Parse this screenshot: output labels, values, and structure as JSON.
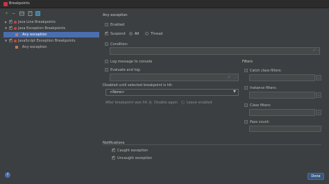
{
  "window": {
    "title": "Breakpoints"
  },
  "toolbar": {
    "add": "+",
    "remove": "−"
  },
  "tree": {
    "items": [
      {
        "label": "Java Line Breakpoints",
        "level": 0,
        "expanded": false,
        "checked": true
      },
      {
        "label": "Java Exception Breakpoints",
        "level": 0,
        "expanded": true,
        "checked": true
      },
      {
        "label": "Any exception",
        "level": 1,
        "selected": true
      },
      {
        "label": "JavaScript Exception Breakpoints",
        "level": 0,
        "expanded": true,
        "checked": true
      },
      {
        "label": "Any exception",
        "level": 1,
        "selected": false
      }
    ]
  },
  "details": {
    "title": "Any exception",
    "enabled": "Enabled",
    "suspend": "Suspend",
    "suspend_all": "All",
    "suspend_thread": "Thread",
    "condition": "Condition:",
    "log_message": "Log message to console",
    "evaluate_log": "Evaluate and log:",
    "disabled_until": "Disabled until selected breakpoint is hit:",
    "disabled_until_value": "<None>",
    "after_hit": "After breakpoint was hit",
    "disable_again": "Disable again",
    "leave_enabled": "Leave enabled",
    "filters_title": "Filters",
    "catch_class_filters": "Catch class filters:",
    "instance_filters": "Instance filters:",
    "class_filters": "Class filters:",
    "pass_count": "Pass count:",
    "notifications_title": "Notifications",
    "caught_exception": "Caught exception",
    "uncaught_exception": "Uncaught exception"
  },
  "footer": {
    "done": "Done",
    "help": "?"
  }
}
